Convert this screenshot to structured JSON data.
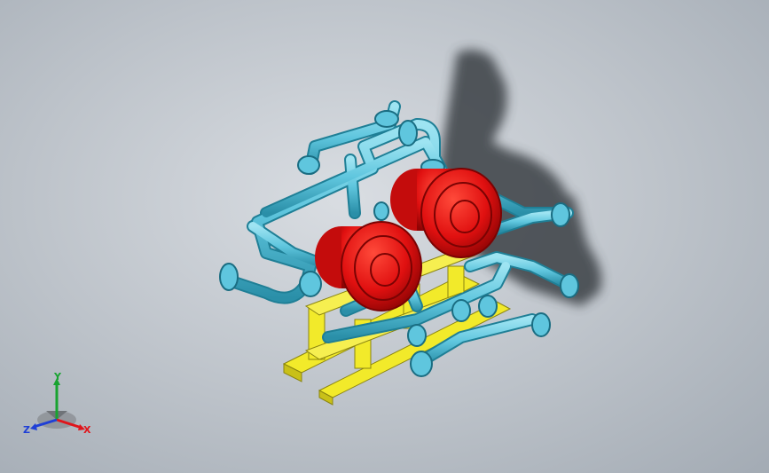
{
  "scene": {
    "model": "heat-exchanger-skid",
    "colors": {
      "background_center": "#d9dde2",
      "background_edge": "#a3abb4",
      "pipe": "#5fc6de",
      "pipe_dark": "#2a8fa8",
      "vessel": "#e01010",
      "vessel_dark": "#9a0606",
      "frame": "#f2ea2a",
      "frame_dark": "#a79f10",
      "shadow": "#3a3f44"
    }
  },
  "triad": {
    "x_label": "X",
    "y_label": "Y",
    "z_label": "Z",
    "x_color": "#e0151b",
    "y_color": "#18a330",
    "z_color": "#1f3fd6"
  }
}
